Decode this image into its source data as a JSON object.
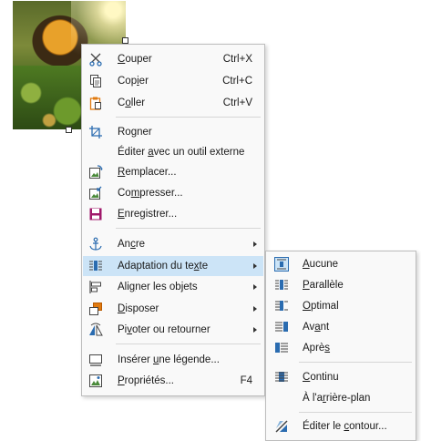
{
  "context_menu": {
    "items": [
      {
        "pre": "",
        "u": "C",
        "post": "ouper",
        "accel": "Ctrl+X",
        "icon": "scissors-icon"
      },
      {
        "pre": "Cop",
        "u": "i",
        "post": "er",
        "accel": "Ctrl+C",
        "icon": "copy-icon"
      },
      {
        "pre": "C",
        "u": "o",
        "post": "ller",
        "accel": "Ctrl+V",
        "icon": "paste-icon"
      },
      {
        "pre": "Ro",
        "u": "g",
        "post": "ner",
        "accel": "",
        "icon": "crop-icon"
      },
      {
        "pre": "Éditer ",
        "u": "a",
        "post": "vec un outil externe",
        "accel": "",
        "icon": ""
      },
      {
        "pre": "",
        "u": "R",
        "post": "emplacer...",
        "accel": "",
        "icon": "replace-image-icon"
      },
      {
        "pre": "Co",
        "u": "m",
        "post": "presser...",
        "accel": "",
        "icon": "compress-image-icon"
      },
      {
        "pre": "",
        "u": "E",
        "post": "nregistrer...",
        "accel": "",
        "icon": "save-icon"
      },
      {
        "pre": "An",
        "u": "c",
        "post": "re",
        "accel": "",
        "icon": "anchor-icon"
      },
      {
        "pre": "Adaptation du te",
        "u": "x",
        "post": "te",
        "accel": "",
        "icon": "text-wrap-icon"
      },
      {
        "pre": "Ali",
        "u": "g",
        "post": "ner les objets",
        "accel": "",
        "icon": "align-objects-icon"
      },
      {
        "pre": "",
        "u": "D",
        "post": "isposer",
        "accel": "",
        "icon": "arrange-icon"
      },
      {
        "pre": "Pi",
        "u": "v",
        "post": "oter ou retourner",
        "accel": "",
        "icon": "rotate-flip-icon"
      },
      {
        "pre": "Insérer ",
        "u": "u",
        "post": "ne légende...",
        "accel": "",
        "icon": "caption-icon"
      },
      {
        "pre": "",
        "u": "P",
        "post": "ropriétés...",
        "accel": "F4",
        "icon": "properties-icon"
      }
    ]
  },
  "wrap_submenu": {
    "items": [
      {
        "pre": "",
        "u": "A",
        "post": "ucune",
        "icon": "wrap-none-icon"
      },
      {
        "pre": "",
        "u": "P",
        "post": "arallèle",
        "icon": "wrap-parallel-icon"
      },
      {
        "pre": "",
        "u": "O",
        "post": "ptimal",
        "icon": "wrap-optimal-icon"
      },
      {
        "pre": "Av",
        "u": "a",
        "post": "nt",
        "icon": "wrap-before-icon"
      },
      {
        "pre": "Aprè",
        "u": "s",
        "post": "",
        "icon": "wrap-after-icon"
      },
      {
        "pre": "",
        "u": "C",
        "post": "ontinu",
        "icon": "wrap-through-icon"
      },
      {
        "pre": "À l'a",
        "u": "r",
        "post": "rière-plan",
        "icon": ""
      },
      {
        "pre": "Éditer le ",
        "u": "c",
        "post": "ontour...",
        "icon": "edit-contour-icon"
      }
    ]
  },
  "colors": {
    "highlight": "#cce4f7",
    "menu_bg": "#f9f9f9",
    "icon_blue": "#2b6cb0",
    "icon_orange": "#e07a10",
    "save_purple": "#a0186a"
  }
}
